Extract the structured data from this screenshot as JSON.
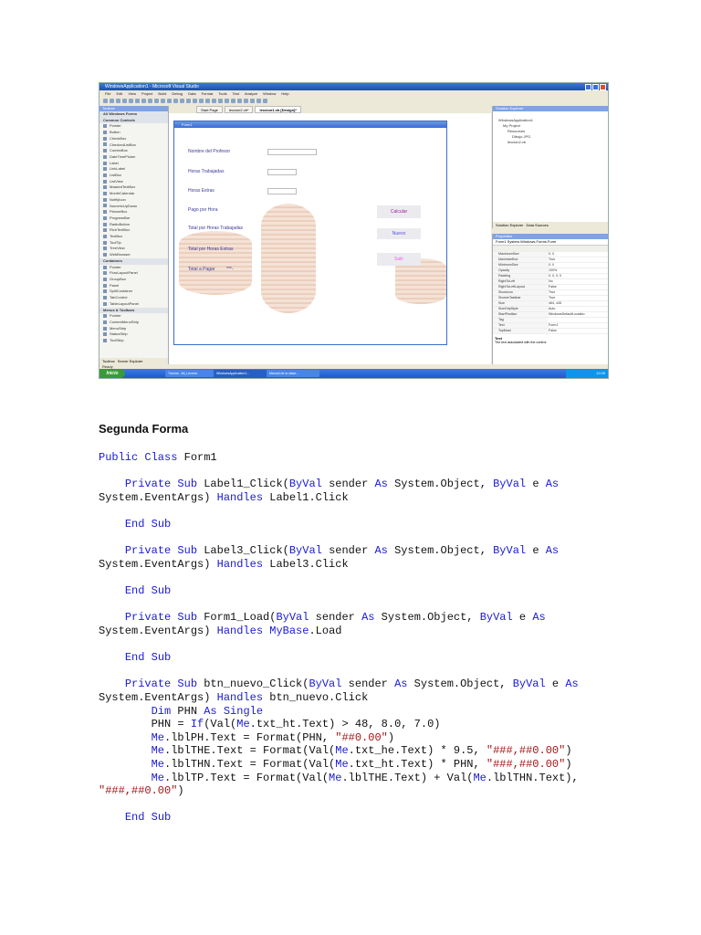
{
  "screenshot": {
    "window_title": "WindowsApplication1 - Microsoft Visual Studio",
    "menu": [
      "File",
      "Edit",
      "View",
      "Project",
      "Build",
      "Debug",
      "Data",
      "Format",
      "Tools",
      "Test",
      "Analyze",
      "Window",
      "Help"
    ],
    "toolbox": {
      "title": "Toolbox",
      "items": [
        {
          "label": "All Windows Forms",
          "group": true
        },
        {
          "label": "Common Controls",
          "group": true
        },
        {
          "label": "Pointer"
        },
        {
          "label": "Button"
        },
        {
          "label": "CheckBox"
        },
        {
          "label": "CheckedListBox"
        },
        {
          "label": "ComboBox"
        },
        {
          "label": "DateTimePicker"
        },
        {
          "label": "Label"
        },
        {
          "label": "LinkLabel"
        },
        {
          "label": "ListBox"
        },
        {
          "label": "ListView"
        },
        {
          "label": "MaskedTextBox"
        },
        {
          "label": "MonthCalendar"
        },
        {
          "label": "NotifyIcon"
        },
        {
          "label": "NumericUpDown"
        },
        {
          "label": "PictureBox"
        },
        {
          "label": "ProgressBar"
        },
        {
          "label": "RadioButton"
        },
        {
          "label": "RichTextBox"
        },
        {
          "label": "TextBox"
        },
        {
          "label": "ToolTip"
        },
        {
          "label": "TreeView"
        },
        {
          "label": "WebBrowser"
        },
        {
          "label": "Containers",
          "group": true
        },
        {
          "label": "Pointer"
        },
        {
          "label": "FlowLayoutPanel"
        },
        {
          "label": "GroupBox"
        },
        {
          "label": "Panel"
        },
        {
          "label": "SplitContainer"
        },
        {
          "label": "TabControl"
        },
        {
          "label": "TableLayoutPanel"
        },
        {
          "label": "Menus & Toolbars",
          "group": true
        },
        {
          "label": "Pointer"
        },
        {
          "label": "ContextMenuStrip"
        },
        {
          "label": "MenuStrip"
        },
        {
          "label": "StatusStrip"
        },
        {
          "label": "ToolStrip"
        }
      ],
      "bottom_tabs": [
        "Toolbox",
        "Server Explorer"
      ]
    },
    "doc_tabs": [
      "Start Page",
      "leccion2.vb*",
      "leccion1.vb [Design]*"
    ],
    "form": {
      "title": "Form1",
      "labels": [
        "Nombre del Profesor",
        "Horas Trabajadas",
        "Horas Extras",
        "Pago por Hora",
        "Total por Horas Trabajadas",
        "Total por Horas Extras",
        "Total a Pagar"
      ],
      "total_value": "***-",
      "buttons": {
        "calcular": "Calcular",
        "nuevo": "Nuevo",
        "salir": "Salir"
      },
      "button_colors": {
        "calcular": "#a020a0",
        "nuevo": "#5a50e0",
        "salir": "#f060f0"
      }
    },
    "solution_explorer": {
      "title": "Solution Explorer",
      "tree": [
        "WindowsApplication1",
        "My Project",
        "Resources",
        "Dibujo.JPG",
        "leccion2.vb"
      ],
      "tabs": [
        "Solution Explorer",
        "Data Sources"
      ]
    },
    "properties": {
      "title": "Properties",
      "object": "Form1 System.Windows.Forms.Form",
      "rows": [
        [
          "MaximumSize",
          "0, 0"
        ],
        [
          "MaximizeBox",
          "True"
        ],
        [
          "MinimumSize",
          "0, 0"
        ],
        [
          "Opacity",
          "100%"
        ],
        [
          "Padding",
          "0, 0, 0, 0"
        ],
        [
          "RightToLeft",
          "No"
        ],
        [
          "RightToLeftLayout",
          "False"
        ],
        [
          "ShowIcon",
          "True"
        ],
        [
          "ShowInTaskbar",
          "True"
        ],
        [
          "Size",
          "464, 445"
        ],
        [
          "SizeGripStyle",
          "Auto"
        ],
        [
          "StartPosition",
          "WindowsDefaultLocation"
        ],
        [
          "Tag",
          ""
        ],
        [
          "Text",
          "Form1"
        ],
        [
          "TopMost",
          "False"
        ]
      ],
      "desc_title": "Text",
      "desc": "The text associated with the control."
    },
    "status": "Ready",
    "taskbar": {
      "start": "Inicio",
      "tasks": [
        "",
        "Tutorial - Mi_Leccion",
        "WindowsApplication1...",
        "Manual de la clase..."
      ],
      "clock": "12:05"
    }
  },
  "heading": "Segunda Forma",
  "code_lines": [
    [
      {
        "t": "Public Class",
        "k": "kw"
      },
      {
        "t": " Form1"
      }
    ],
    [],
    [
      {
        "t": "    "
      },
      {
        "t": "Private Sub",
        "k": "kw"
      },
      {
        "t": " Label1_Click("
      },
      {
        "t": "ByVal",
        "k": "kw"
      },
      {
        "t": " sender "
      },
      {
        "t": "As",
        "k": "kw"
      },
      {
        "t": " System.Object, "
      },
      {
        "t": "ByVal",
        "k": "kw"
      },
      {
        "t": " e "
      },
      {
        "t": "As",
        "k": "kw"
      }
    ],
    [
      {
        "t": "System.EventArgs) "
      },
      {
        "t": "Handles",
        "k": "kw"
      },
      {
        "t": " Label1.Click"
      }
    ],
    [],
    [
      {
        "t": "    "
      },
      {
        "t": "End Sub",
        "k": "kw"
      }
    ],
    [],
    [
      {
        "t": "    "
      },
      {
        "t": "Private Sub",
        "k": "kw"
      },
      {
        "t": " Label3_Click("
      },
      {
        "t": "ByVal",
        "k": "kw"
      },
      {
        "t": " sender "
      },
      {
        "t": "As",
        "k": "kw"
      },
      {
        "t": " System.Object, "
      },
      {
        "t": "ByVal",
        "k": "kw"
      },
      {
        "t": " e "
      },
      {
        "t": "As",
        "k": "kw"
      }
    ],
    [
      {
        "t": "System.EventArgs) "
      },
      {
        "t": "Handles",
        "k": "kw"
      },
      {
        "t": " Label3.Click"
      }
    ],
    [],
    [
      {
        "t": "    "
      },
      {
        "t": "End Sub",
        "k": "kw"
      }
    ],
    [],
    [
      {
        "t": "    "
      },
      {
        "t": "Private Sub",
        "k": "kw"
      },
      {
        "t": " Form1_Load("
      },
      {
        "t": "ByVal",
        "k": "kw"
      },
      {
        "t": " sender "
      },
      {
        "t": "As",
        "k": "kw"
      },
      {
        "t": " System.Object, "
      },
      {
        "t": "ByVal",
        "k": "kw"
      },
      {
        "t": " e "
      },
      {
        "t": "As",
        "k": "kw"
      }
    ],
    [
      {
        "t": "System.EventArgs) "
      },
      {
        "t": "Handles",
        "k": "kw"
      },
      {
        "t": " "
      },
      {
        "t": "MyBase",
        "k": "kw"
      },
      {
        "t": ".Load"
      }
    ],
    [],
    [
      {
        "t": "    "
      },
      {
        "t": "End Sub",
        "k": "kw"
      }
    ],
    [],
    [
      {
        "t": "    "
      },
      {
        "t": "Private Sub",
        "k": "kw"
      },
      {
        "t": " btn_nuevo_Click("
      },
      {
        "t": "ByVal",
        "k": "kw"
      },
      {
        "t": " sender "
      },
      {
        "t": "As",
        "k": "kw"
      },
      {
        "t": " System.Object, "
      },
      {
        "t": "ByVal",
        "k": "kw"
      },
      {
        "t": " e "
      },
      {
        "t": "As",
        "k": "kw"
      }
    ],
    [
      {
        "t": "System.EventArgs) "
      },
      {
        "t": "Handles",
        "k": "kw"
      },
      {
        "t": " btn_nuevo.Click"
      }
    ],
    [
      {
        "t": "        "
      },
      {
        "t": "Dim",
        "k": "kw"
      },
      {
        "t": " PHN "
      },
      {
        "t": "As",
        "k": "kw"
      },
      {
        "t": " "
      },
      {
        "t": "Single",
        "k": "kw"
      }
    ],
    [
      {
        "t": "        PHN = "
      },
      {
        "t": "If",
        "k": "kw"
      },
      {
        "t": "(Val("
      },
      {
        "t": "Me",
        "k": "kw"
      },
      {
        "t": ".txt_ht.Text) > 48, 8.0, 7.0)"
      }
    ],
    [
      {
        "t": "        "
      },
      {
        "t": "Me",
        "k": "kw"
      },
      {
        "t": ".lblPH.Text = Format(PHN, "
      },
      {
        "t": "\"##0.00\"",
        "k": "st"
      },
      {
        "t": ")"
      }
    ],
    [
      {
        "t": "        "
      },
      {
        "t": "Me",
        "k": "kw"
      },
      {
        "t": ".lblTHE.Text = Format(Val("
      },
      {
        "t": "Me",
        "k": "kw"
      },
      {
        "t": ".txt_he.Text) * 9.5, "
      },
      {
        "t": "\"###,##0.00\"",
        "k": "st"
      },
      {
        "t": ")"
      }
    ],
    [
      {
        "t": "        "
      },
      {
        "t": "Me",
        "k": "kw"
      },
      {
        "t": ".lblTHN.Text = Format(Val("
      },
      {
        "t": "Me",
        "k": "kw"
      },
      {
        "t": ".txt_ht.Text) * PHN, "
      },
      {
        "t": "\"###,##0.00\"",
        "k": "st"
      },
      {
        "t": ")"
      }
    ],
    [
      {
        "t": "        "
      },
      {
        "t": "Me",
        "k": "kw"
      },
      {
        "t": ".lblTP.Text = Format(Val("
      },
      {
        "t": "Me",
        "k": "kw"
      },
      {
        "t": ".lblTHE.Text) + Val("
      },
      {
        "t": "Me",
        "k": "kw"
      },
      {
        "t": ".lblTHN.Text),"
      }
    ],
    [
      {
        "t": "\"###,##0.00\"",
        "k": "st"
      },
      {
        "t": ")"
      }
    ],
    [],
    [
      {
        "t": "    "
      },
      {
        "t": "End Sub",
        "k": "kw"
      }
    ]
  ]
}
